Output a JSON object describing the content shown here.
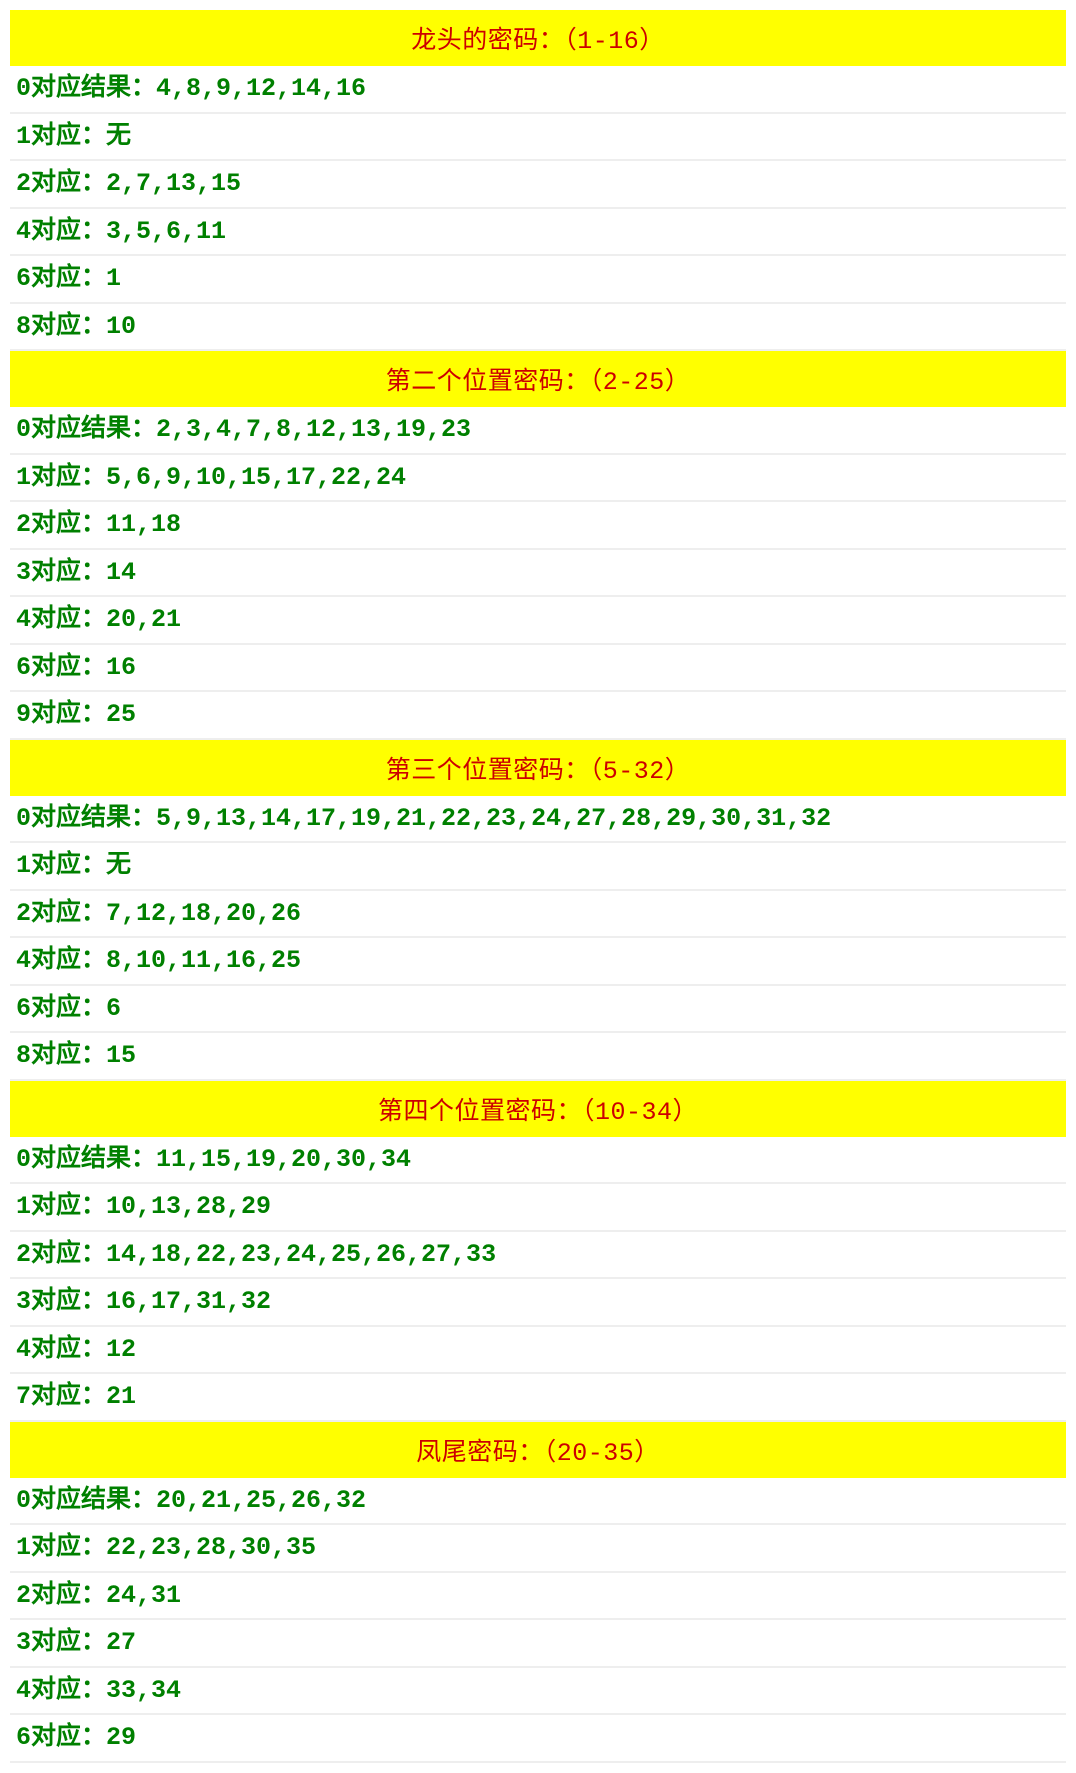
{
  "sections": [
    {
      "title": "龙头的密码：（1-16）",
      "rows": [
        "0对应结果：4,8,9,12,14,16",
        "1对应：无",
        "2对应：2,7,13,15",
        "4对应：3,5,6,11",
        "6对应：1",
        "8对应：10"
      ]
    },
    {
      "title": "第二个位置密码：（2-25）",
      "rows": [
        "0对应结果：2,3,4,7,8,12,13,19,23",
        "1对应：5,6,9,10,15,17,22,24",
        "2对应：11,18",
        "3对应：14",
        "4对应：20,21",
        "6对应：16",
        "9对应：25"
      ]
    },
    {
      "title": "第三个位置密码：（5-32）",
      "rows": [
        "0对应结果：5,9,13,14,17,19,21,22,23,24,27,28,29,30,31,32",
        "1对应：无",
        "2对应：7,12,18,20,26",
        "4对应：8,10,11,16,25",
        "6对应：6",
        "8对应：15"
      ]
    },
    {
      "title": "第四个位置密码：（10-34）",
      "rows": [
        "0对应结果：11,15,19,20,30,34",
        "1对应：10,13,28,29",
        "2对应：14,18,22,23,24,25,26,27,33",
        "3对应：16,17,31,32",
        "4对应：12",
        "7对应：21"
      ]
    },
    {
      "title": "凤尾密码：（20-35）",
      "rows": [
        "0对应结果：20,21,25,26,32",
        "1对应：22,23,28,30,35",
        "2对应：24,31",
        "3对应：27",
        "4对应：33,34",
        "6对应：29"
      ]
    }
  ]
}
